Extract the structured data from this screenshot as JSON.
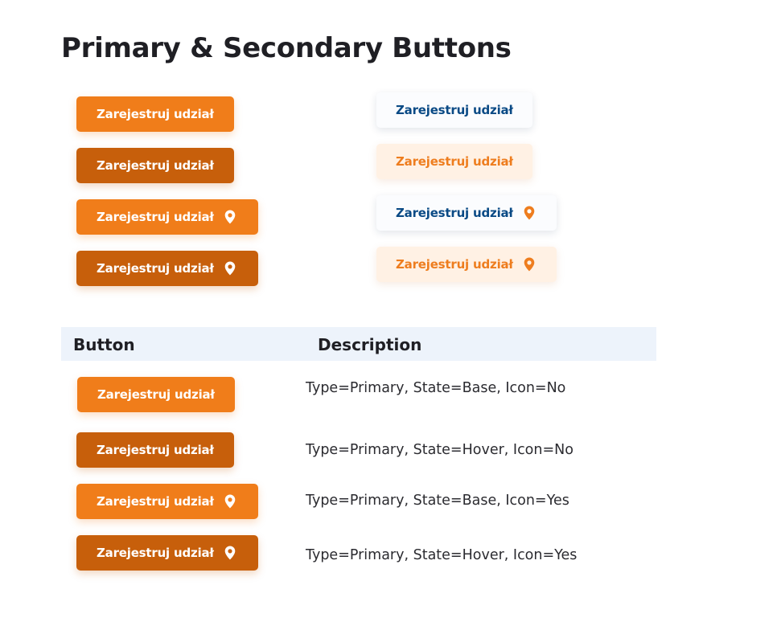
{
  "page": {
    "title": "Primary & Secondary Buttons"
  },
  "button_label": "Zarejestruj udział",
  "icons": {
    "pin": "location-pin-icon"
  },
  "colors": {
    "primary_base": "#f07d1a",
    "primary_hover": "#c75f0b",
    "secondary_text": "#0a4a85",
    "secondary_hover_bg": "#fff1e4",
    "table_header_bg": "#edf3fb"
  },
  "table": {
    "headers": {
      "button": "Button",
      "description": "Description"
    },
    "rows": [
      {
        "description": "Type=Primary, State=Base, Icon=No"
      },
      {
        "description": "Type=Primary, State=Hover, Icon=No"
      },
      {
        "description": "Type=Primary, State=Base, Icon=Yes"
      },
      {
        "description": "Type=Primary, State=Hover, Icon=Yes"
      }
    ]
  }
}
